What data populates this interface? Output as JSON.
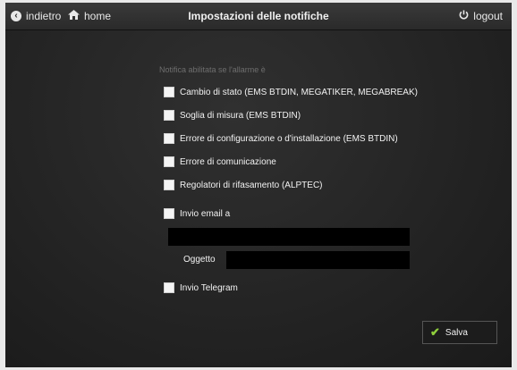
{
  "topbar": {
    "back_label": "indietro",
    "home_label": "home",
    "title": "Impostazioni delle notifiche",
    "logout_label": "logout"
  },
  "section_label": "Notifica abilitata se l'allarme è",
  "options": [
    {
      "label": "Cambio di stato (EMS BTDIN, MEGATIKER, MEGABREAK)",
      "checked": false
    },
    {
      "label": "Soglia di misura (EMS BTDIN)",
      "checked": false
    },
    {
      "label": "Errore di configurazione o d'installazione (EMS BTDIN)",
      "checked": false
    },
    {
      "label": "Errore di comunicazione",
      "checked": false
    },
    {
      "label": "Regolatori di rifasamento (ALPTEC)",
      "checked": false
    }
  ],
  "email": {
    "label": "Invio email a",
    "checked": false,
    "value": ""
  },
  "subject": {
    "label": "Oggetto",
    "value": ""
  },
  "telegram": {
    "label": "Invio Telegram",
    "checked": false
  },
  "save_label": "Salva",
  "colors": {
    "accent": "#8fcf3c",
    "background": "#262626"
  }
}
